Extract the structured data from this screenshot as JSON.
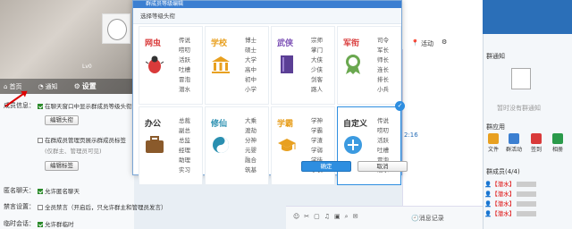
{
  "profile": {
    "level_tag": "Lv0",
    "tabs": [
      "首页",
      "通知",
      "设置"
    ]
  },
  "settings": {
    "member_info_label": "成员信息：",
    "show_level_opt": "在聊天窗口中显示群成员等级头衔",
    "edit_title_btn": "编辑头衔",
    "show_tag_opt": "在群成员管理页展示群成员标签",
    "show_tag_sub": "(仅群主、管理员可见)",
    "edit_tag_btn": "编辑标签",
    "anon_label": "匿名聊天：",
    "anon_opt": "允许匿名聊天",
    "mute_label": "禁言设置：",
    "mute_opt": "全员禁言（开启后，只允许群主和管理员发言）",
    "temp_label": "临时会话：",
    "temp_opt": "允许群临时"
  },
  "dialog": {
    "title": "群成员等级编辑",
    "subtitle": "选择等级头衔",
    "cards": [
      {
        "name": "网虫",
        "color": "#d93a3a",
        "icon": "bug-icon",
        "levels": [
          "传说",
          "唠叨",
          "活跃",
          "吐槽",
          "冒泡",
          "潜水"
        ]
      },
      {
        "name": "学校",
        "color": "#e8a020",
        "icon": "school-icon",
        "levels": [
          "博士",
          "硕士",
          "大学",
          "高中",
          "初中",
          "小学"
        ]
      },
      {
        "name": "武侠",
        "color": "#7b4fb5",
        "icon": "book-icon",
        "levels": [
          "宗师",
          "掌门",
          "大侠",
          "少侠",
          "剑客",
          "路人"
        ]
      },
      {
        "name": "军衔",
        "color": "#d93a3a",
        "icon": "medal-icon",
        "levels": [
          "司令",
          "军长",
          "师长",
          "连长",
          "排长",
          "小兵"
        ]
      },
      {
        "name": "办公",
        "color": "#333333",
        "icon": "briefcase-icon",
        "levels": [
          "总裁",
          "副总",
          "总监",
          "经理",
          "助理",
          "实习"
        ]
      },
      {
        "name": "修仙",
        "color": "#2a8fb0",
        "icon": "yin-yang-icon",
        "levels": [
          "大乘",
          "渡劫",
          "分神",
          "元婴",
          "融合",
          "筑基"
        ]
      },
      {
        "name": "学霸",
        "color": "#e8a020",
        "icon": "graduation-cap-icon",
        "levels": [
          "学神",
          "学霸",
          "学渣",
          "学弱",
          "学徒",
          "学长"
        ]
      },
      {
        "name": "自定义",
        "color": "#333333",
        "icon": "plus-icon",
        "levels": [
          "传说",
          "唠叨",
          "活跃",
          "吐槽",
          "冒泡",
          "潜水"
        ]
      }
    ],
    "ok": "确定",
    "cancel": "取消"
  },
  "chat": {
    "pin_label": "置顶",
    "activity_label": "活动",
    "time_stamp": "2:16",
    "history": "消息记录"
  },
  "right_panel": {
    "notice_title": "群通知",
    "no_notice": "暂时没有群通知",
    "apps_title": "群应用",
    "apps": [
      {
        "label": "文件",
        "color": "#e8a020"
      },
      {
        "label": "群活动",
        "color": "#3b7fd1"
      },
      {
        "label": "签到",
        "color": "#d93a3a"
      },
      {
        "label": "相册",
        "color": "#2a9a4a"
      }
    ],
    "members_title": "群成员(4/4)",
    "members": [
      "【潜水】",
      "【潜水】",
      "【潜水】",
      "【潜水】"
    ]
  }
}
